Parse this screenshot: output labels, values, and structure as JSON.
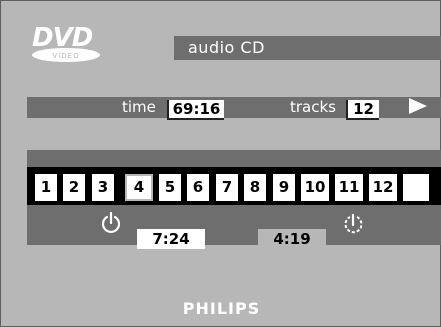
{
  "title": "audio CD",
  "info": {
    "time_label": "time",
    "time_value": "69:16",
    "tracks_label": "tracks",
    "tracks_value": "12"
  },
  "tracks": [
    "1",
    "2",
    "3",
    "4",
    "5",
    "6",
    "7",
    "8",
    "9",
    "10",
    "11",
    "12",
    ""
  ],
  "selected_track": "4",
  "times": {
    "elapsed": "7:24",
    "remaining": "4:19"
  },
  "logo": {
    "text": "DVD",
    "subtext": "VIDEO"
  },
  "brand": "PHILIPS",
  "colors": {
    "background": "#b7b7b7",
    "bar": "#6e6e6e",
    "highlight": "#ffffff"
  },
  "icons": [
    "dvd-video-logo-icon",
    "play-icon",
    "power-icon",
    "repeat-icon"
  ]
}
